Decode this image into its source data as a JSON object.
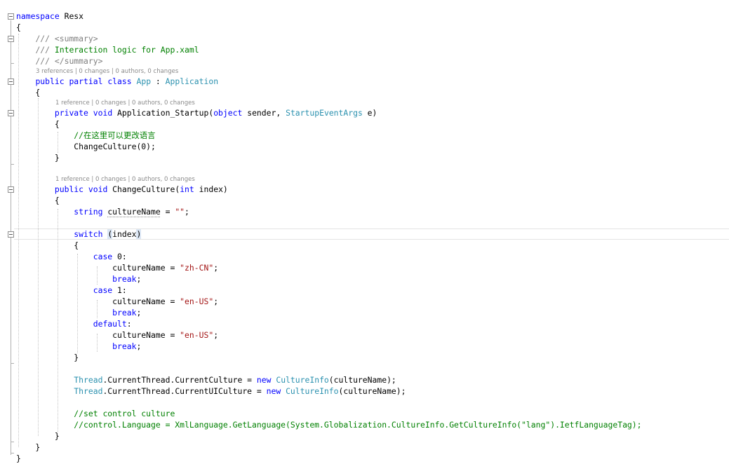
{
  "editor": {
    "lines": [
      [
        [
          "namespace",
          "kw"
        ],
        [
          " Resx",
          ""
        ]
      ],
      [
        [
          "{",
          ""
        ]
      ],
      [
        [
          "    ",
          ""
        ],
        [
          "///",
          "xd"
        ],
        [
          " ",
          "cm"
        ],
        [
          "<summary>",
          "xd"
        ]
      ],
      [
        [
          "    ",
          ""
        ],
        [
          "///",
          "xd"
        ],
        [
          " Interaction logic for App.xaml",
          "cm"
        ]
      ],
      [
        [
          "    ",
          ""
        ],
        [
          "///",
          "xd"
        ],
        [
          " ",
          "cm"
        ],
        [
          "</summary>",
          "xd"
        ]
      ],
      [
        [
          "    ",
          ""
        ],
        [
          "public",
          "kw"
        ],
        [
          " ",
          ""
        ],
        [
          "partial",
          "kw"
        ],
        [
          " ",
          ""
        ],
        [
          "class",
          "kw"
        ],
        [
          " ",
          ""
        ],
        [
          "App",
          "ty"
        ],
        [
          " : ",
          ""
        ],
        [
          "Application",
          "ty"
        ]
      ],
      [
        [
          "    {",
          ""
        ]
      ],
      [
        [
          "        ",
          ""
        ],
        [
          "private",
          "kw"
        ],
        [
          " ",
          ""
        ],
        [
          "void",
          "kw"
        ],
        [
          " Application_Startup(",
          ""
        ],
        [
          "object",
          "kw"
        ],
        [
          " sender, ",
          ""
        ],
        [
          "StartupEventArgs",
          "ty"
        ],
        [
          " e)",
          ""
        ]
      ],
      [
        [
          "        {",
          ""
        ]
      ],
      [
        [
          "            ",
          ""
        ],
        [
          "//在这里可以更改语言",
          "cm"
        ]
      ],
      [
        [
          "            ChangeCulture(0);",
          ""
        ]
      ],
      [
        [
          "        }",
          ""
        ]
      ],
      [
        [
          "",
          ""
        ]
      ],
      [
        [
          "        ",
          ""
        ],
        [
          "public",
          "kw"
        ],
        [
          " ",
          ""
        ],
        [
          "void",
          "kw"
        ],
        [
          " ChangeCulture(",
          ""
        ],
        [
          "int",
          "kw"
        ],
        [
          " index)",
          ""
        ]
      ],
      [
        [
          "        {",
          ""
        ]
      ],
      [
        [
          "            ",
          ""
        ],
        [
          "string",
          "kw"
        ],
        [
          " ",
          ""
        ],
        [
          "cultureName",
          "squig"
        ],
        [
          " = ",
          ""
        ],
        [
          "\"\"",
          "st"
        ],
        [
          ";",
          ""
        ]
      ],
      [
        [
          "",
          ""
        ]
      ],
      [
        [
          "            ",
          ""
        ],
        [
          "switch",
          "kw"
        ],
        [
          " ",
          ""
        ],
        [
          "(",
          "bh"
        ],
        [
          "index",
          ""
        ],
        [
          ")",
          "bh"
        ]
      ],
      [
        [
          "            {",
          ""
        ]
      ],
      [
        [
          "                ",
          ""
        ],
        [
          "case",
          "kw"
        ],
        [
          " 0:",
          ""
        ]
      ],
      [
        [
          "                    cultureName = ",
          ""
        ],
        [
          "\"zh-CN\"",
          "st"
        ],
        [
          ";",
          ""
        ]
      ],
      [
        [
          "                    ",
          ""
        ],
        [
          "break",
          "kw"
        ],
        [
          ";",
          ""
        ]
      ],
      [
        [
          "                ",
          ""
        ],
        [
          "case",
          "kw"
        ],
        [
          " 1:",
          ""
        ]
      ],
      [
        [
          "                    cultureName = ",
          ""
        ],
        [
          "\"en-US\"",
          "st"
        ],
        [
          ";",
          ""
        ]
      ],
      [
        [
          "                    ",
          ""
        ],
        [
          "break",
          "kw"
        ],
        [
          ";",
          ""
        ]
      ],
      [
        [
          "                ",
          ""
        ],
        [
          "default",
          "kw"
        ],
        [
          ":",
          ""
        ]
      ],
      [
        [
          "                    cultureName = ",
          ""
        ],
        [
          "\"en-US\"",
          "st"
        ],
        [
          ";",
          ""
        ]
      ],
      [
        [
          "                    ",
          ""
        ],
        [
          "break",
          "kw"
        ],
        [
          ";",
          ""
        ]
      ],
      [
        [
          "            }",
          ""
        ]
      ],
      [
        [
          "",
          ""
        ]
      ],
      [
        [
          "            ",
          ""
        ],
        [
          "Thread",
          "ty"
        ],
        [
          ".CurrentThread.CurrentCulture = ",
          ""
        ],
        [
          "new",
          "kw"
        ],
        [
          " ",
          ""
        ],
        [
          "CultureInfo",
          "ty"
        ],
        [
          "(cultureName);",
          ""
        ]
      ],
      [
        [
          "            ",
          ""
        ],
        [
          "Thread",
          "ty"
        ],
        [
          ".CurrentThread.CurrentUICulture = ",
          ""
        ],
        [
          "new",
          "kw"
        ],
        [
          " ",
          ""
        ],
        [
          "CultureInfo",
          "ty"
        ],
        [
          "(cultureName);",
          ""
        ]
      ],
      [
        [
          "",
          ""
        ]
      ],
      [
        [
          "            ",
          ""
        ],
        [
          "//set control culture",
          "cm"
        ]
      ],
      [
        [
          "            ",
          ""
        ],
        [
          "//control.Language = XmlLanguage.GetLanguage(System.Globalization.CultureInfo.GetCultureInfo(\"lang\").IetfLanguageTag);",
          "cm"
        ]
      ],
      [
        [
          "        }",
          ""
        ]
      ],
      [
        [
          "    }",
          ""
        ]
      ],
      [
        [
          "}",
          ""
        ]
      ]
    ],
    "codelens": [
      "3 references | 0 changes | 0 authors, 0 changes",
      "1 reference | 0 changes | 0 authors, 0 changes",
      "1 reference | 0 changes | 0 authors, 0 changes"
    ]
  }
}
